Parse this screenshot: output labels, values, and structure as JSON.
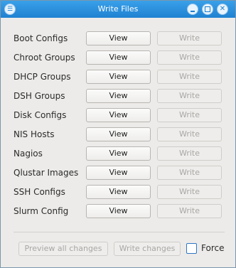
{
  "window": {
    "title": "Write Files"
  },
  "titlebar": {
    "menu_icon": "menu-icon",
    "minimize_icon": "minimize-icon",
    "maximize_icon": "maximize-icon",
    "close_icon": "close-icon",
    "close_glyph": "✕",
    "menu_glyph": "☰"
  },
  "rows": [
    {
      "label": "Boot Configs",
      "view_label": "View",
      "write_label": "Write"
    },
    {
      "label": "Chroot Groups",
      "view_label": "View",
      "write_label": "Write"
    },
    {
      "label": "DHCP Groups",
      "view_label": "View",
      "write_label": "Write"
    },
    {
      "label": "DSH Groups",
      "view_label": "View",
      "write_label": "Write"
    },
    {
      "label": "Disk Configs",
      "view_label": "View",
      "write_label": "Write"
    },
    {
      "label": "NIS Hosts",
      "view_label": "View",
      "write_label": "Write"
    },
    {
      "label": "Nagios",
      "view_label": "View",
      "write_label": "Write"
    },
    {
      "label": "Qlustar Images",
      "view_label": "View",
      "write_label": "Write"
    },
    {
      "label": "SSH Configs",
      "view_label": "View",
      "write_label": "Write"
    },
    {
      "label": "Slurm Config",
      "view_label": "View",
      "write_label": "Write"
    }
  ],
  "footer": {
    "preview_label": "Preview all changes",
    "write_changes_label": "Write changes",
    "force_label": "Force",
    "force_checked": false
  },
  "colors": {
    "titlebar": "#2a8fdc",
    "window_bg": "#ecebe9",
    "checkbox_border": "#2f77c4"
  }
}
